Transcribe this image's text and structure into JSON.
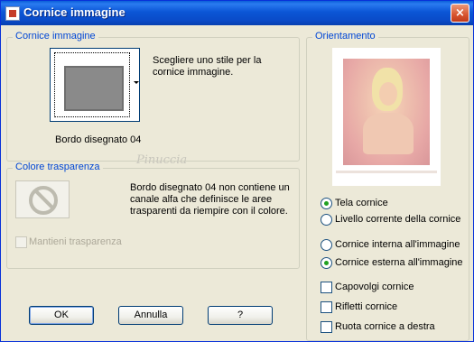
{
  "window": {
    "title": "Cornice immagine",
    "close_glyph": "×"
  },
  "frame_group": {
    "legend": "Cornice immagine",
    "description": "Scegliere uno stile per la cornice immagine.",
    "selected_frame": "Bordo disegnato 04"
  },
  "transparency_group": {
    "legend": "Colore trasparenza",
    "message": "Bordo disegnato 04 non contiene un canale alfa che definisce le aree trasparenti da riempire con il colore.",
    "keep_transparency_label": "Mantieni trasparenza",
    "keep_transparency_checked": false,
    "keep_transparency_enabled": false
  },
  "watermark": "Pinuccia",
  "orientation_group": {
    "legend": "Orientamento",
    "apply_to": [
      {
        "label": "Tela cornice",
        "checked": true
      },
      {
        "label": "Livello corrente della cornice",
        "checked": false
      }
    ],
    "frame_position": [
      {
        "label": "Cornice interna all'immagine",
        "checked": false
      },
      {
        "label": "Cornice esterna all'immagine",
        "checked": true
      }
    ],
    "options": [
      {
        "label": "Capovolgi cornice",
        "checked": false
      },
      {
        "label": "Rifletti cornice",
        "checked": false
      },
      {
        "label": "Ruota cornice a destra",
        "checked": false
      }
    ]
  },
  "buttons": {
    "ok": "OK",
    "cancel": "Annulla",
    "help": "?"
  },
  "icons": {
    "title": "app-icon",
    "frame_dropdown": "chevron-down-icon",
    "no_transparency": "prohibited-icon"
  },
  "colors": {
    "titlebar": "#0b56d6",
    "dialog_background": "#ece9d8",
    "group_legend": "#0046d5",
    "close_button": "#d8542f",
    "radio_selected": "#21a121"
  }
}
